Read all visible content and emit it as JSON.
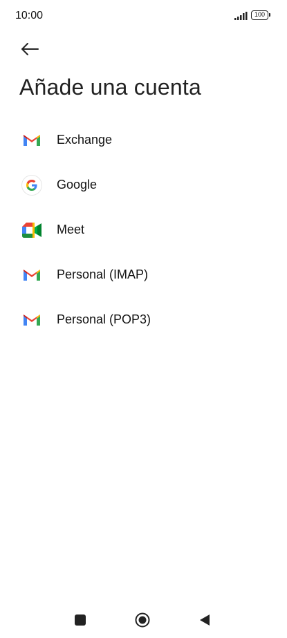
{
  "status_bar": {
    "time": "10:00",
    "battery": "100"
  },
  "header": {
    "back_icon": "arrow-left-icon",
    "title": "Añade una cuenta"
  },
  "accounts": [
    {
      "label": "Exchange",
      "icon": "gmail-icon"
    },
    {
      "label": "Google",
      "icon": "google-icon"
    },
    {
      "label": "Meet",
      "icon": "meet-icon"
    },
    {
      "label": "Personal (IMAP)",
      "icon": "gmail-icon"
    },
    {
      "label": "Personal (POP3)",
      "icon": "gmail-icon"
    }
  ],
  "nav_bar": {
    "recents_icon": "square-icon",
    "home_icon": "circle-icon",
    "back_icon": "triangle-back-icon"
  },
  "colors": {
    "gmail_red": "#EA4335",
    "gmail_blue": "#4285F4",
    "gmail_green": "#34A853",
    "gmail_yellow": "#FBBC04"
  }
}
